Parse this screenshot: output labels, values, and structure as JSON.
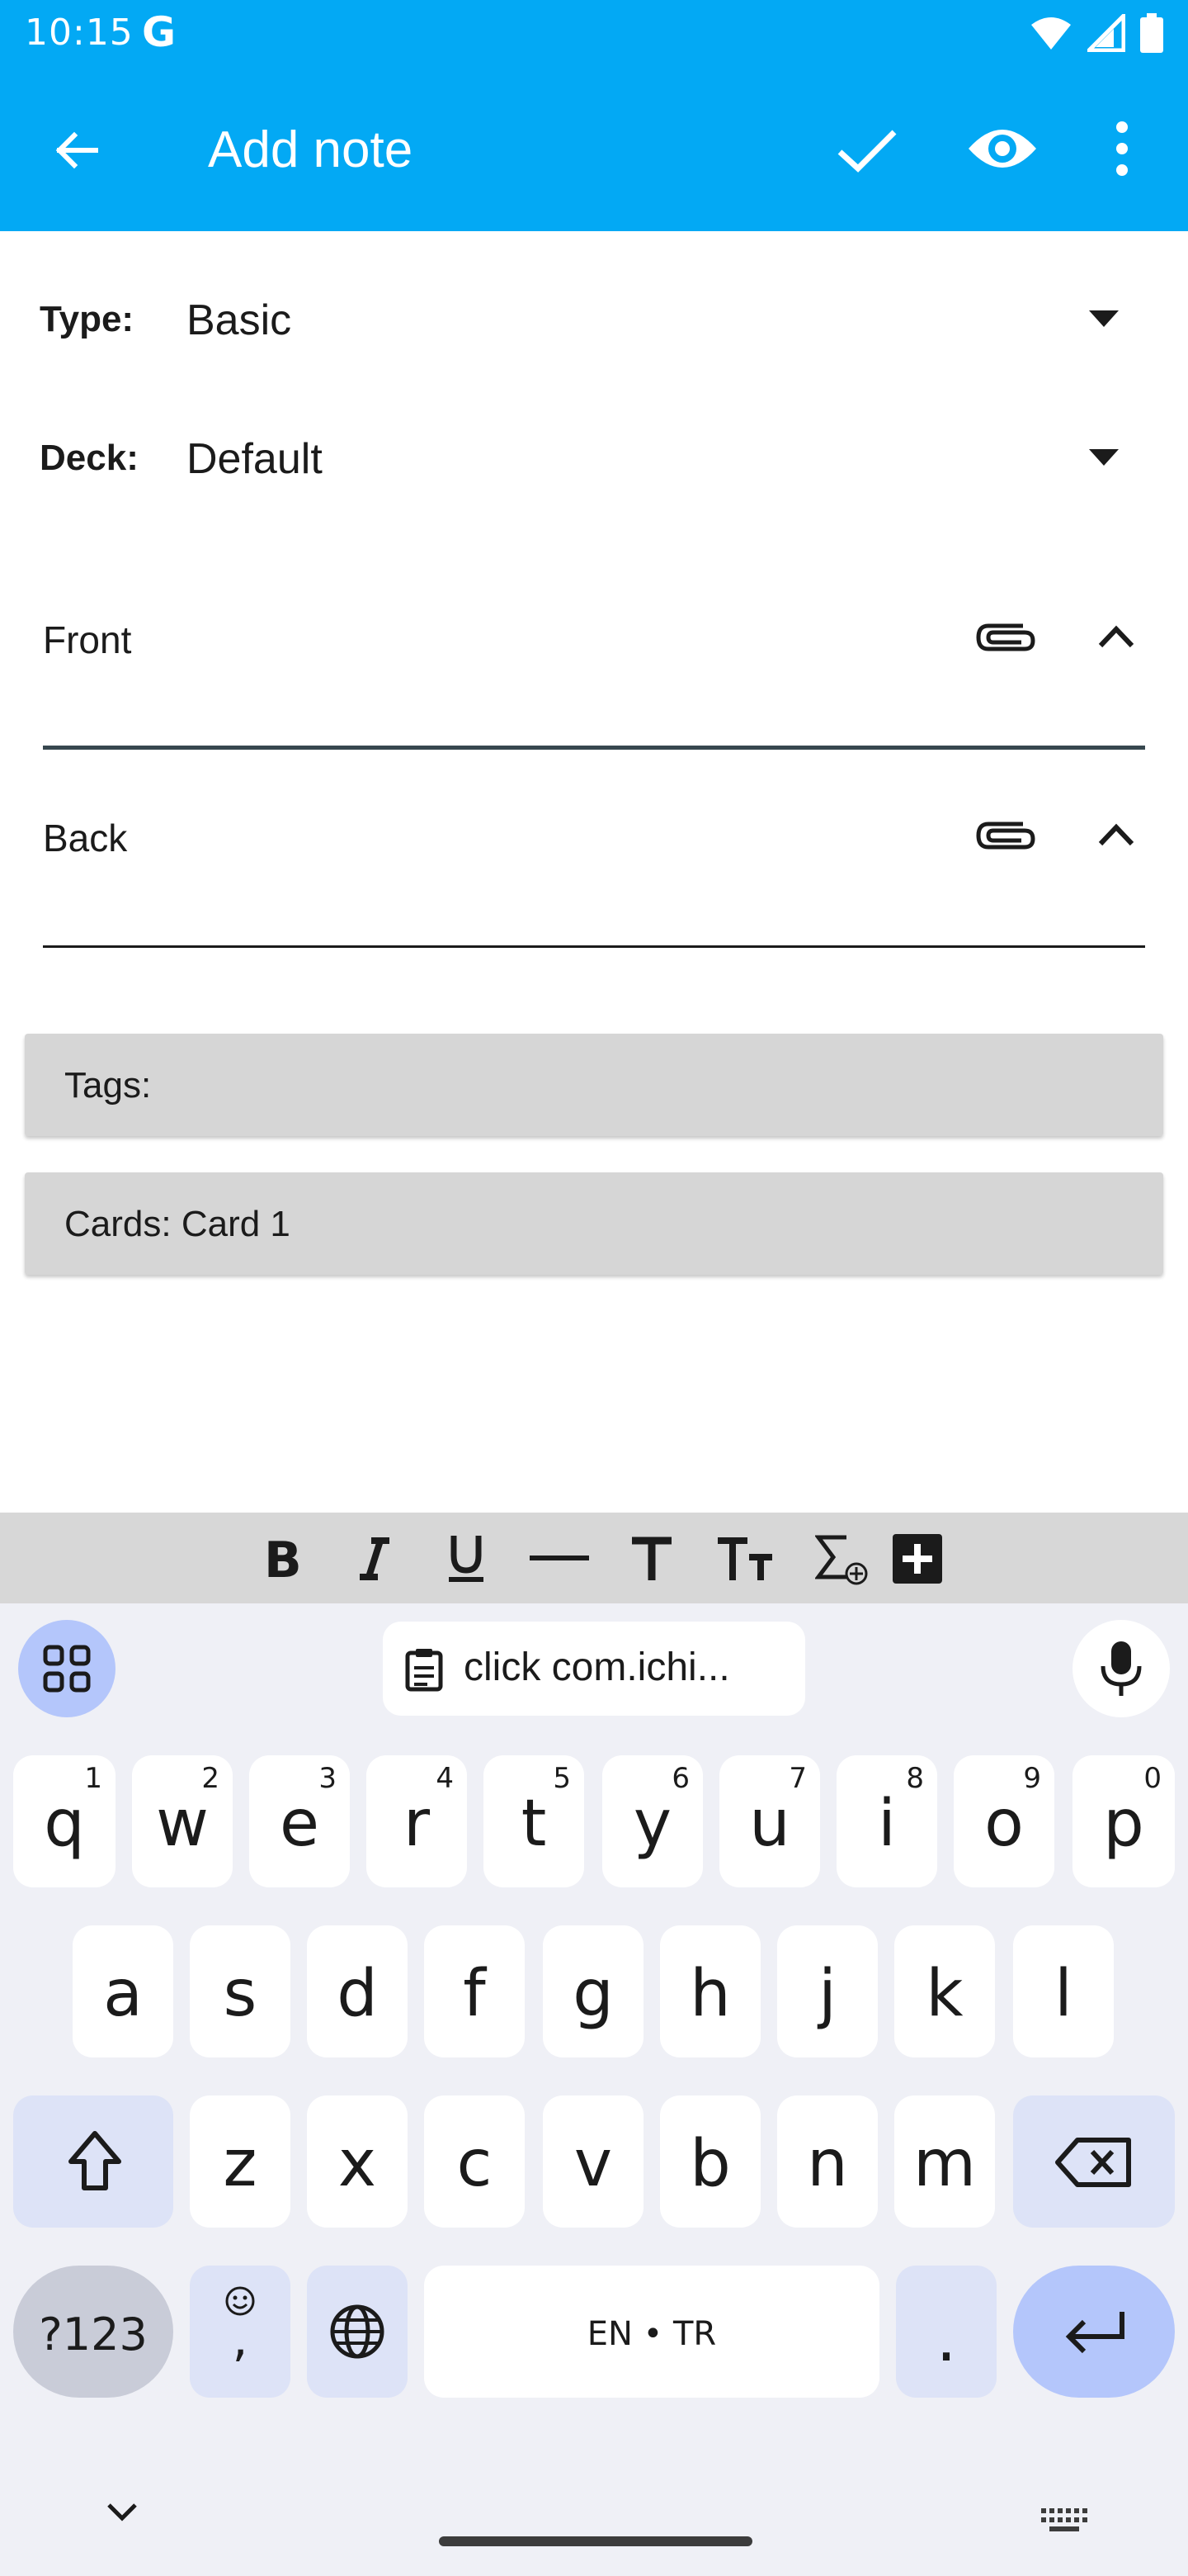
{
  "status_bar": {
    "time": "10:15",
    "google_badge": "G"
  },
  "app_bar": {
    "title": "Add note"
  },
  "form": {
    "type_label": "Type:",
    "type_value": "Basic",
    "deck_label": "Deck:",
    "deck_value": "Default",
    "fields": [
      {
        "name": "Front",
        "value": ""
      },
      {
        "name": "Back",
        "value": ""
      }
    ],
    "tags_label": "Tags:",
    "cards_label": "Cards: Card 1"
  },
  "keyboard": {
    "clipboard_suggestion": "click com.ichi...",
    "row1": [
      {
        "ch": "q",
        "hint": "1"
      },
      {
        "ch": "w",
        "hint": "2"
      },
      {
        "ch": "e",
        "hint": "3"
      },
      {
        "ch": "r",
        "hint": "4"
      },
      {
        "ch": "t",
        "hint": "5"
      },
      {
        "ch": "y",
        "hint": "6"
      },
      {
        "ch": "u",
        "hint": "7"
      },
      {
        "ch": "i",
        "hint": "8"
      },
      {
        "ch": "o",
        "hint": "9"
      },
      {
        "ch": "p",
        "hint": "0"
      }
    ],
    "row2": [
      "a",
      "s",
      "d",
      "f",
      "g",
      "h",
      "j",
      "k",
      "l"
    ],
    "row3": [
      "z",
      "x",
      "c",
      "v",
      "b",
      "n",
      "m"
    ],
    "symbols_label": "?123",
    "emoji_comma": ",",
    "space_label": "EN • TR",
    "period_label": "."
  },
  "colors": {
    "app_bar": "#03a9f4",
    "chip_bg": "#d6d6d6",
    "keyboard_bg": "#eff0f6",
    "modifier_key": "#dde3f7",
    "enter_key": "#b4c6fb"
  }
}
